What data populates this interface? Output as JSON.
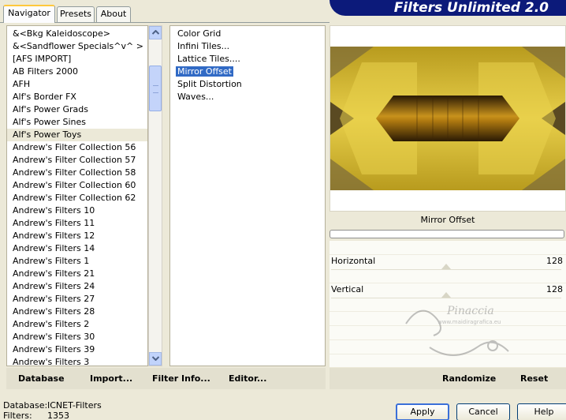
{
  "tabs": [
    {
      "label": "Navigator",
      "active": true
    },
    {
      "label": "Presets",
      "active": false
    },
    {
      "label": "About",
      "active": false
    }
  ],
  "banner_title": "Filters Unlimited 2.0",
  "categories": [
    "&<Bkg Kaleidoscope>",
    "&<Sandflower Specials^v^ >",
    "[AFS IMPORT]",
    "AB Filters 2000",
    "AFH",
    "Alf's Border FX",
    "Alf's Power Grads",
    "Alf's Power Sines",
    "Alf's Power Toys",
    "Andrew's Filter Collection 56",
    "Andrew's Filter Collection 57",
    "Andrew's Filter Collection 58",
    "Andrew's Filter Collection 60",
    "Andrew's Filter Collection 62",
    "Andrew's Filters 10",
    "Andrew's Filters 11",
    "Andrew's Filters 12",
    "Andrew's Filters 14",
    "Andrew's Filters 1",
    "Andrew's Filters 21",
    "Andrew's Filters 24",
    "Andrew's Filters 27",
    "Andrew's Filters 28",
    "Andrew's Filters 2",
    "Andrew's Filters 30",
    "Andrew's Filters 39",
    "Andrew's Filters 3"
  ],
  "selected_category": "Alf's Power Toys",
  "filters": [
    "Color Grid",
    "Infini Tiles...",
    "Lattice Tiles....",
    "Mirror Offset",
    "Split Distortion",
    "Waves..."
  ],
  "selected_filter": "Mirror Offset",
  "links": {
    "database": "Database",
    "import": "Import...",
    "filter_info": "Filter Info...",
    "editor": "Editor...",
    "randomize": "Randomize",
    "reset": "Reset"
  },
  "filter_name": "Mirror Offset",
  "controls": [
    {
      "label": "Horizontal",
      "value": "128",
      "position": 0.5
    },
    {
      "label": "Vertical",
      "value": "128",
      "position": 0.5
    }
  ],
  "status": {
    "database_label": "Database:",
    "database_value": "ICNET-Filters",
    "filters_label": "Filters:",
    "filters_value": "1353"
  },
  "buttons": {
    "apply": "Apply",
    "cancel": "Cancel",
    "help": "Help"
  },
  "watermark_text": "Pinaccia www.maidiragrafica.eu",
  "colors": {
    "selection": "#316ac5",
    "banner": "#0c1a7a",
    "preview_gold": "#d4b52a",
    "preview_brown": "#5a3a0a"
  }
}
